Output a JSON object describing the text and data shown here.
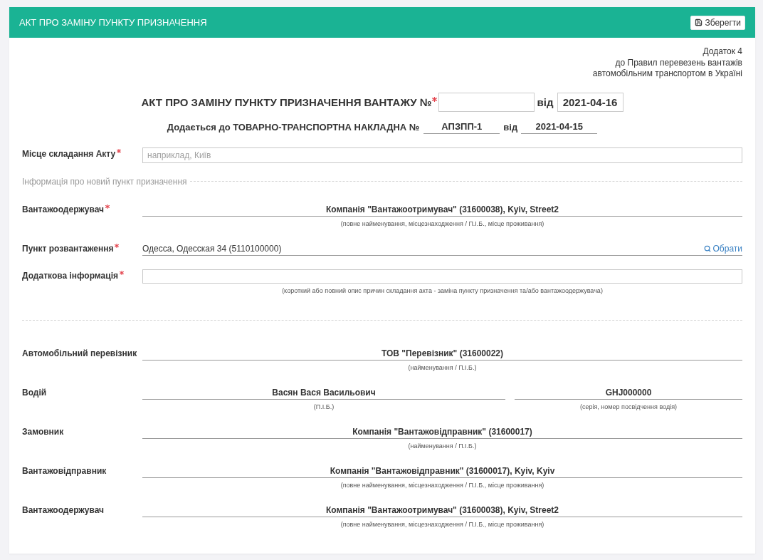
{
  "header": {
    "title": "АКТ ПРО ЗАМІНУ ПУНКТУ ПРИЗНАЧЕННЯ",
    "save_button": "Зберегти"
  },
  "annex_note": [
    "Додаток 4",
    "до Правил перевезень вантажів",
    "автомобільним транспортом в Україні"
  ],
  "act_heading": {
    "title": "АКТ ПРО ЗАМІНУ ПУНКТУ ПРИЗНАЧЕННЯ ВАНТАЖУ №",
    "required": true,
    "date_label": "від",
    "date": "2021-04-16"
  },
  "attachment": {
    "text": "Додається до ТОВАРНО-ТРАНСПОРТНА НАКЛАДНА №",
    "number": "АПЗПП-1",
    "date_label": "від",
    "date": "2021-04-15"
  },
  "place": {
    "label": "Місце складання Акту",
    "required": true,
    "placeholder": "наприклад, Київ"
  },
  "new_destination": {
    "legend": "Інформація про новий пункт призначення",
    "fields": [
      {
        "kind": "display",
        "label": "Вантажоодержувач",
        "required": true,
        "value": "Компанія \"Вантажоотримувач\" (31600038), Kyiv, Street2",
        "hint": "(повне найменування, місцезнаходження / П.І.Б., місце проживання)"
      },
      {
        "kind": "picker",
        "label": "Пункт розвантаження",
        "required": true,
        "value": "Одесса, Одесская 34 (5110100000)",
        "action": "Обрати"
      },
      {
        "kind": "input",
        "label": "Додаткова інформація",
        "required": true,
        "hint": "(короткий або повний опис причин складання акта - заміна пункту призначення та/або вантажоодержувача)"
      }
    ]
  },
  "parties": [
    {
      "label": "Автомобільний перевізник",
      "cells": [
        {
          "value": "ТОВ \"Перевізник\" (31600022)",
          "hint": "(найменування / П.І.Б.)"
        }
      ]
    },
    {
      "label": "Водій",
      "cells": [
        {
          "value": "Васян Вася Васильович",
          "hint": "(П.І.Б.)"
        },
        {
          "value": "GHJ000000",
          "hint": "(серія, номер посвідчення водія)"
        }
      ]
    },
    {
      "label": "Замовник",
      "cells": [
        {
          "value": "Компанія \"Вантажовідправник\" (31600017)",
          "hint": "(найменування / П.І.Б.)"
        }
      ]
    },
    {
      "label": "Вантажовідправник",
      "cells": [
        {
          "value": "Компанія \"Вантажовідправник\" (31600017), Kyiv, Kyiv",
          "hint": "(повне найменування, місцезнаходження / П.І.Б., місце проживання)"
        }
      ]
    },
    {
      "label": "Вантажоодержувач",
      "cells": [
        {
          "value": "Компанія \"Вантажоотримувач\" (31600038), Kyiv, Street2",
          "hint": "(повне найменування, місцезнаходження / П.І.Б., місце проживання)"
        }
      ]
    }
  ]
}
